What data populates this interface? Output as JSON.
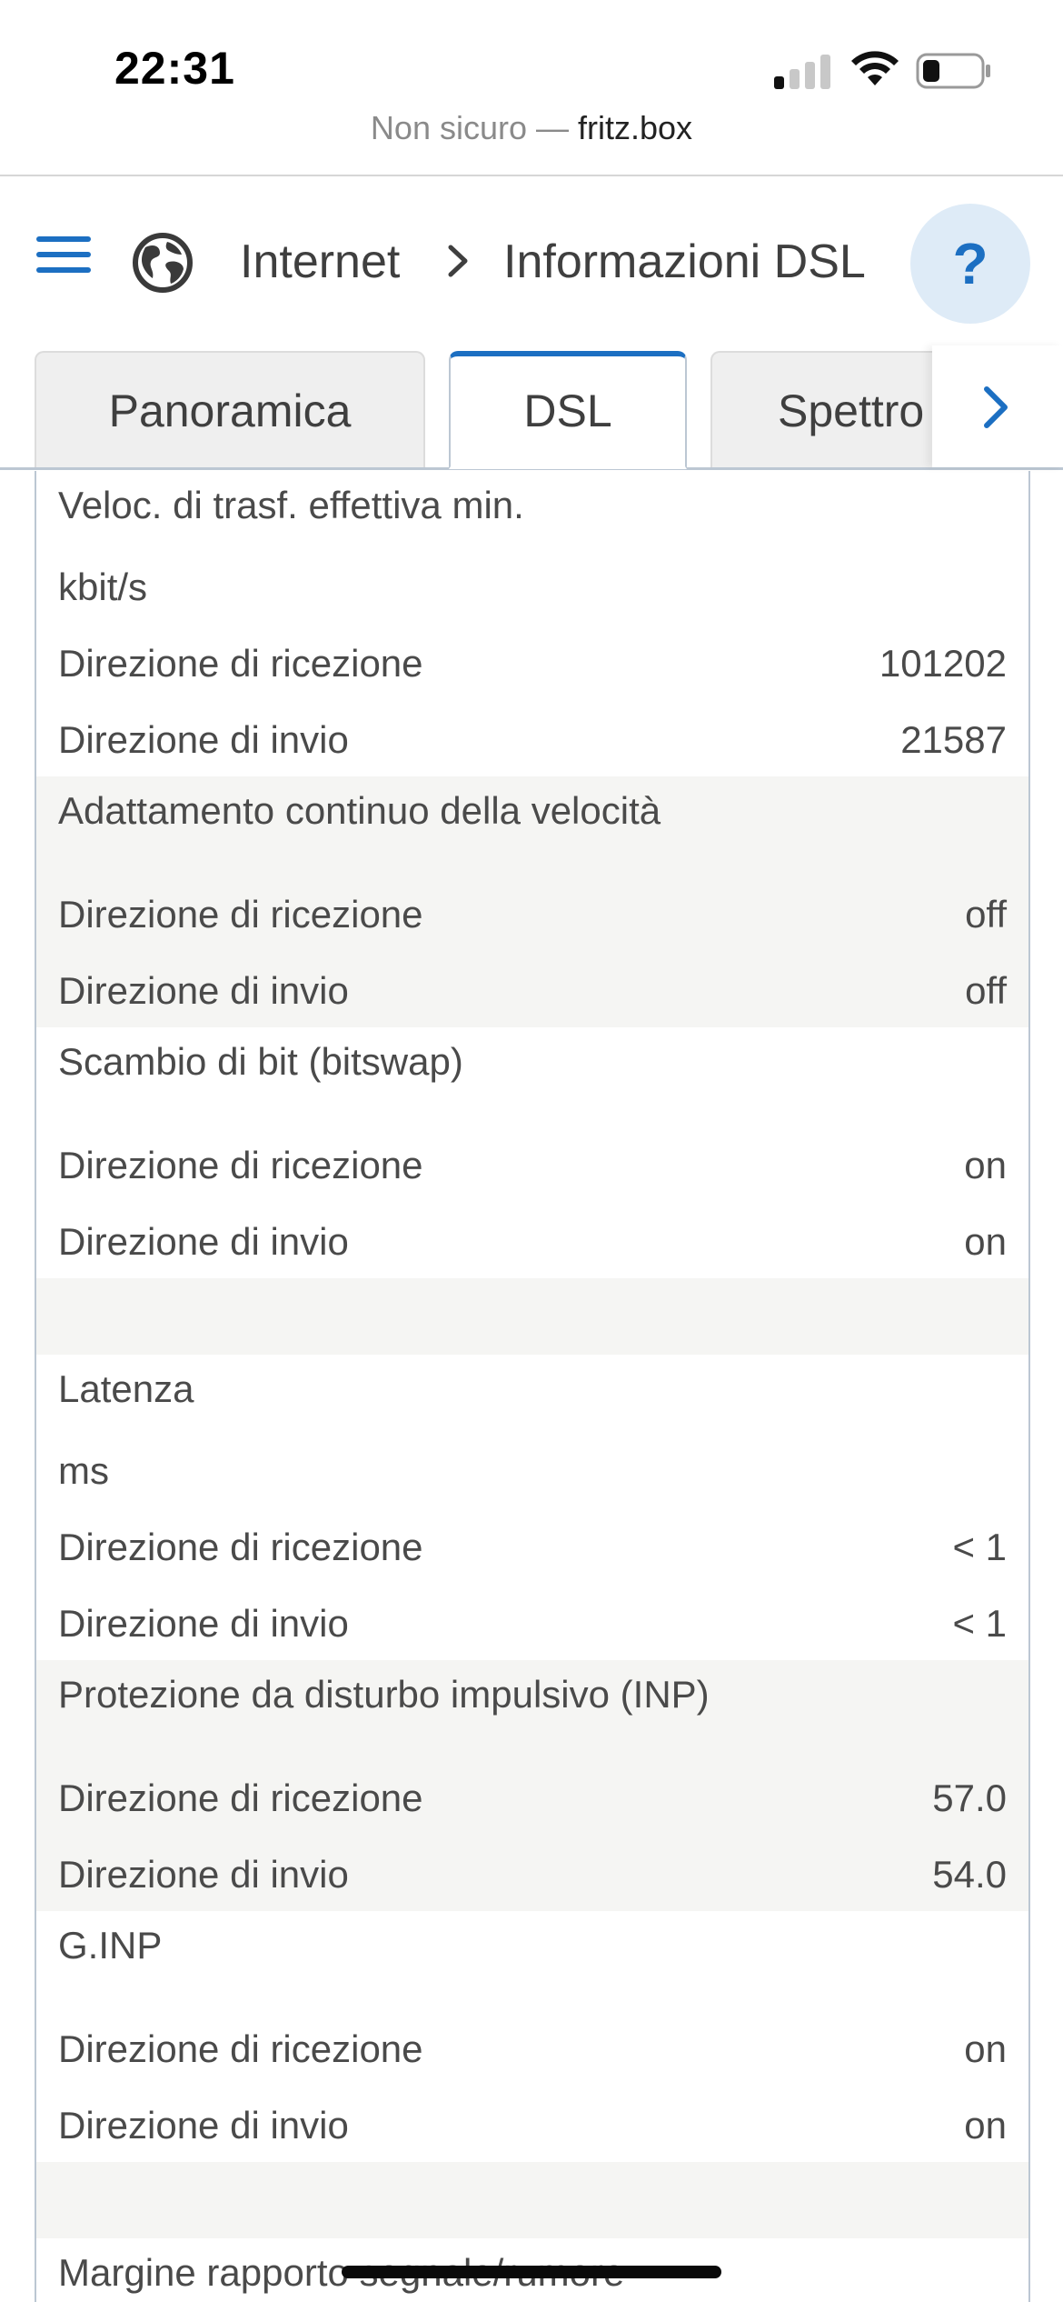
{
  "status_bar": {
    "time": "22:31"
  },
  "url_bar": {
    "security": "Non sicuro —",
    "host": "fritz.box"
  },
  "header": {
    "breadcrumb_1": "Internet",
    "breadcrumb_2": "Informazioni DSL",
    "help_label": "?"
  },
  "tabs": [
    {
      "label": "Panoramica",
      "active": false
    },
    {
      "label": "DSL",
      "active": true
    },
    {
      "label": "Spettro",
      "active": false
    }
  ],
  "table": {
    "s1_title": "Veloc. di trasf. effettiva min.",
    "s1_unit": "kbit/s",
    "s1_rx_label": "Direzione di ricezione",
    "s1_rx_value": "101202",
    "s1_tx_label": "Direzione di invio",
    "s1_tx_value": "21587",
    "s2_title": "Adattamento continuo della velocità",
    "s2_rx_label": "Direzione di ricezione",
    "s2_rx_value": "off",
    "s2_tx_label": "Direzione di invio",
    "s2_tx_value": "off",
    "s3_title": "Scambio di bit (bitswap)",
    "s3_rx_label": "Direzione di ricezione",
    "s3_rx_value": "on",
    "s3_tx_label": "Direzione di invio",
    "s3_tx_value": "on",
    "s4_title": "Latenza",
    "s4_unit": "ms",
    "s4_rx_label": "Direzione di ricezione",
    "s4_rx_value": "< 1",
    "s4_tx_label": "Direzione di invio",
    "s4_tx_value": "< 1",
    "s5_title": "Protezione da disturbo impulsivo (INP)",
    "s5_rx_label": "Direzione di ricezione",
    "s5_rx_value": "57.0",
    "s5_tx_label": "Direzione di invio",
    "s5_tx_value": "54.0",
    "s6_title": "G.INP",
    "s6_rx_label": "Direzione di ricezione",
    "s6_rx_value": "on",
    "s6_tx_label": "Direzione di invio",
    "s6_tx_value": "on",
    "s7_title": "Margine rapporto segnale/rumore"
  },
  "icons": {
    "menu": "hamburger-menu-icon",
    "globe": "globe-icon",
    "breadcrumb_separator": "chevron-right-icon",
    "tabs_more": "chevron-right-icon"
  },
  "colors": {
    "accent": "#1c6fc2",
    "help_bg": "#deebf7",
    "row_gray": "#f5f5f3",
    "border": "#bcc7d3"
  }
}
